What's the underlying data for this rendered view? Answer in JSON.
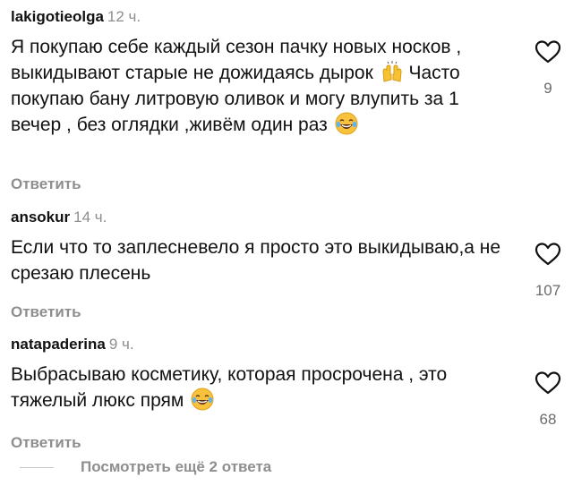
{
  "comments": [
    {
      "username": "lakigotieolga",
      "time": "12 ч.",
      "text_parts": [
        "Я покупаю себе каждый сезон пачку новых носков , выкидывают старые не дожидаясь дырок ",
        " Часто покупаю бану литровую оливок и могу влупить за 1 вечер , без оглядки ,живём один раз "
      ],
      "emojis": [
        "raising-hands-icon",
        "laughing-face-icon"
      ],
      "likes": "9",
      "reply_label": "Ответить"
    },
    {
      "username": "ansokur",
      "time": "14 ч.",
      "text": "Если что то заплесневело я просто это выкидываю,а не срезаю плесень",
      "likes": "107",
      "reply_label": "Ответить"
    },
    {
      "username": "natapaderina",
      "time": "9 ч.",
      "text": "Выбрасываю косметику, которая просрочена , это тяжелый люкс прям ",
      "emojis": [
        "laughing-face-icon"
      ],
      "likes": "68",
      "reply_label": "Ответить"
    }
  ],
  "more_replies_label": "Посмотреть ещё 2 ответа",
  "colors": {
    "text": "#111111",
    "muted": "#8e8e8e",
    "divider": "#c7c7c7"
  }
}
